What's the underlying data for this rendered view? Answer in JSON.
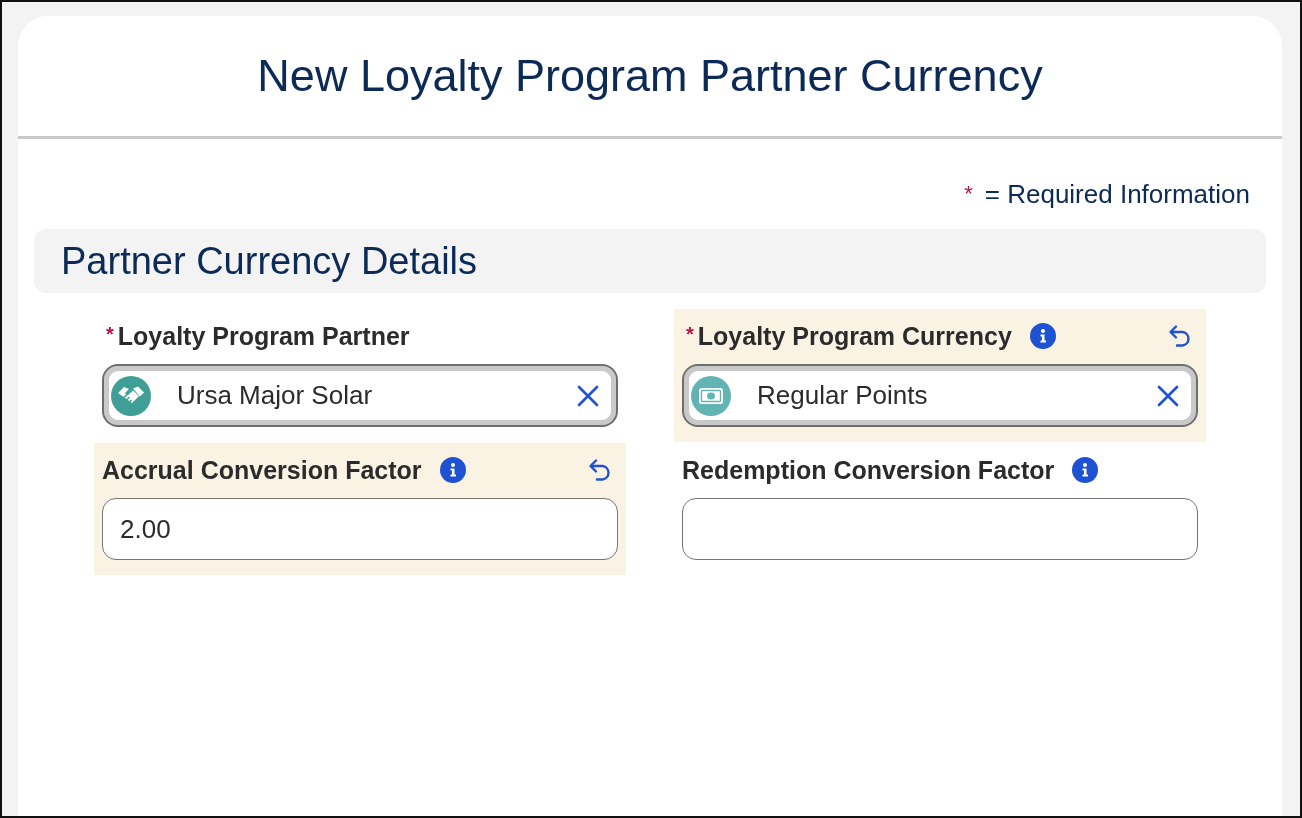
{
  "window": {
    "title": "New Loyalty Program Partner Currency"
  },
  "legend": {
    "marker": "*",
    "text": "= Required Information"
  },
  "section": {
    "title": "Partner Currency Details"
  },
  "fields": [
    {
      "kind": "lookup",
      "label": "Loyalty Program Partner",
      "required_mark": "*",
      "info": false,
      "edited": false,
      "value": "Ursa Major Solar"
    },
    {
      "kind": "lookup",
      "label": "Loyalty Program Currency",
      "required_mark": "*",
      "info": true,
      "edited": true,
      "value": "Regular Points"
    },
    {
      "kind": "number",
      "label": "Accrual Conversion Factor",
      "info": true,
      "edited": true,
      "value": "2.00"
    },
    {
      "kind": "number",
      "label": "Redemption Conversion Factor",
      "info": true,
      "edited": false
    }
  ]
}
